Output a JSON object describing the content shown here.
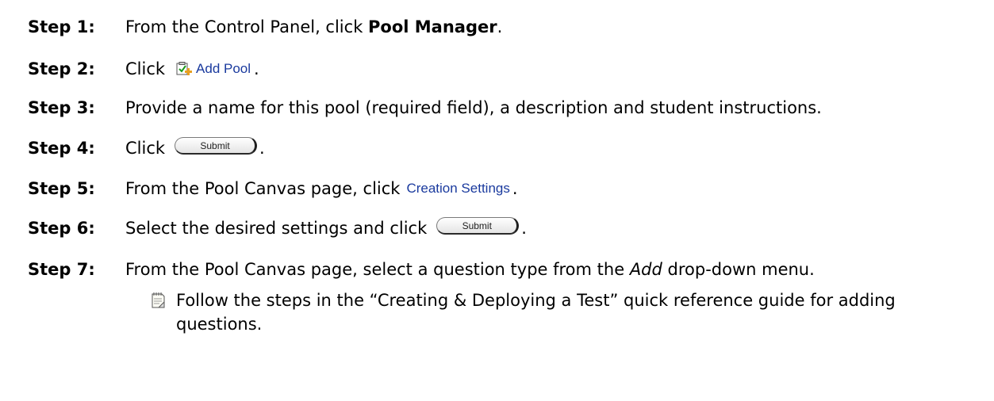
{
  "steps": [
    {
      "label": "Step 1:",
      "before": "From the Control Panel, click ",
      "bold": "Pool Manager",
      "after": "."
    },
    {
      "label": "Step 2:",
      "before": "Click",
      "button_label": "Add Pool",
      "button_icon": "add-pool-icon",
      "after": "."
    },
    {
      "label": "Step 3:",
      "text": "Provide a name for this pool (required field), a description and student instructions."
    },
    {
      "label": "Step 4:",
      "before": "Click",
      "button_label": "Submit",
      "after": "."
    },
    {
      "label": "Step 5:",
      "before": "From the Pool Canvas page, click",
      "link_label": "Creation Settings",
      "after": "."
    },
    {
      "label": "Step 6:",
      "before": "Select the desired settings and click",
      "button_label": "Submit",
      "after": "."
    },
    {
      "label": "Step 7:",
      "before": "From the Pool Canvas page, select a question type from the ",
      "italic": "Add",
      "after": " drop-down menu."
    }
  ],
  "note": {
    "icon": "notepad-icon",
    "text": "Follow the steps in the “Creating & Deploying a Test” quick reference guide for adding questions."
  },
  "colors": {
    "link": "#1a3a9e",
    "text": "#000000"
  }
}
